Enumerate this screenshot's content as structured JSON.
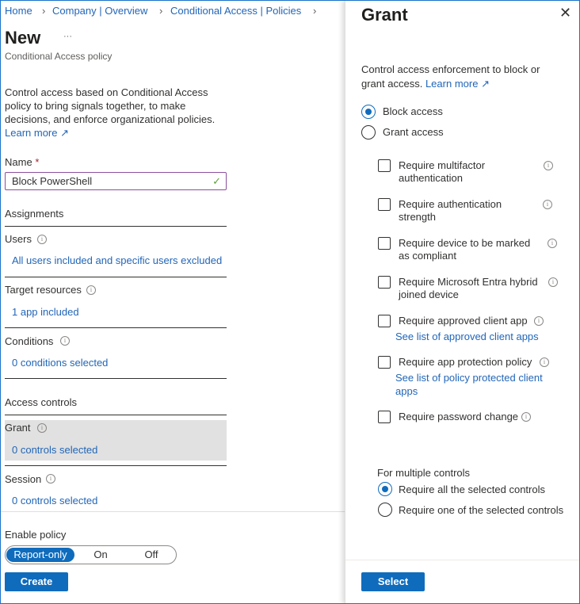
{
  "breadcrumb": {
    "items": [
      "Home",
      "Company | Overview",
      "Conditional Access | Policies"
    ]
  },
  "header": {
    "title": "New",
    "more": "···",
    "subtitle": "Conditional Access policy"
  },
  "description": {
    "lines": [
      "Control access based on Conditional Access",
      "policy to bring signals together, to make",
      "decisions, and enforce organizational policies."
    ],
    "learn_more": "Learn more"
  },
  "name_field": {
    "label": "Name",
    "required": "*",
    "value": "Block PowerShell"
  },
  "assignments": {
    "heading": "Assignments",
    "users": {
      "label": "Users",
      "value": "All users included and specific users excluded"
    },
    "target": {
      "label": "Target resources",
      "value": "1 app included"
    },
    "conditions": {
      "label": "Conditions",
      "value": "0 conditions selected"
    }
  },
  "access_controls": {
    "heading": "Access controls",
    "grant": {
      "label": "Grant",
      "value": "0 controls selected"
    },
    "session": {
      "label": "Session",
      "value": "0 controls selected"
    }
  },
  "enable_policy": {
    "label": "Enable policy",
    "options": [
      "Report-only",
      "On",
      "Off"
    ],
    "selected": "Report-only"
  },
  "create_label": "Create",
  "grant_panel": {
    "title": "Grant",
    "description": [
      "Control access enforcement to block or",
      "grant access."
    ],
    "learn_more": "Learn more",
    "access_options": [
      "Block access",
      "Grant access"
    ],
    "selected_access": "Block access",
    "controls": [
      {
        "lines": [
          "Require multifactor",
          "authentication"
        ]
      },
      {
        "lines": [
          "Require authentication",
          "strength"
        ]
      },
      {
        "lines": [
          "Require device to be marked",
          "as compliant"
        ]
      },
      {
        "lines": [
          "Require Microsoft Entra hybrid",
          "joined device"
        ]
      },
      {
        "lines": [
          "Require approved client app"
        ],
        "link": [
          "See list of approved client apps"
        ]
      },
      {
        "lines": [
          "Require app protection policy"
        ],
        "link": [
          "See list of policy protected client",
          "apps"
        ]
      },
      {
        "lines": [
          "Require password change"
        ]
      }
    ],
    "multiple_heading": "For multiple controls",
    "multiple_options": [
      "Require all the selected controls",
      "Require one of the selected controls"
    ],
    "multiple_selected": "Require all the selected controls",
    "select_label": "Select"
  },
  "colors": {
    "accent": "#0f6cbd",
    "link": "#2266b8",
    "input_border": "#8a4f9e",
    "highlight": "#e1e1e1"
  }
}
